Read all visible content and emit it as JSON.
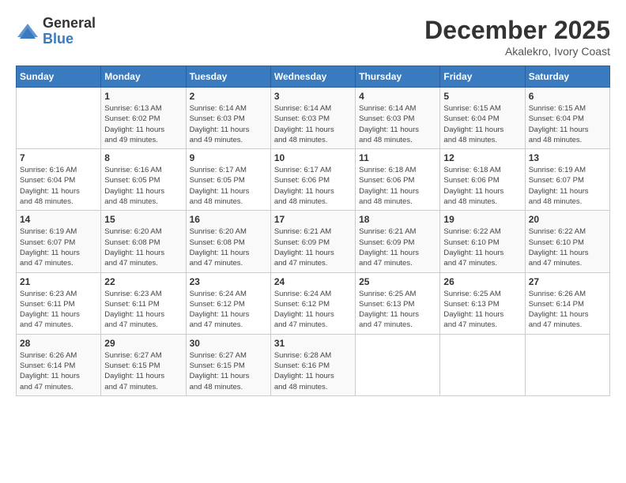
{
  "logo": {
    "general": "General",
    "blue": "Blue"
  },
  "title": "December 2025",
  "location": "Akalekro, Ivory Coast",
  "days_of_week": [
    "Sunday",
    "Monday",
    "Tuesday",
    "Wednesday",
    "Thursday",
    "Friday",
    "Saturday"
  ],
  "weeks": [
    [
      {
        "day": "",
        "info": ""
      },
      {
        "day": "1",
        "info": "Sunrise: 6:13 AM\nSunset: 6:02 PM\nDaylight: 11 hours\nand 49 minutes."
      },
      {
        "day": "2",
        "info": "Sunrise: 6:14 AM\nSunset: 6:03 PM\nDaylight: 11 hours\nand 49 minutes."
      },
      {
        "day": "3",
        "info": "Sunrise: 6:14 AM\nSunset: 6:03 PM\nDaylight: 11 hours\nand 48 minutes."
      },
      {
        "day": "4",
        "info": "Sunrise: 6:14 AM\nSunset: 6:03 PM\nDaylight: 11 hours\nand 48 minutes."
      },
      {
        "day": "5",
        "info": "Sunrise: 6:15 AM\nSunset: 6:04 PM\nDaylight: 11 hours\nand 48 minutes."
      },
      {
        "day": "6",
        "info": "Sunrise: 6:15 AM\nSunset: 6:04 PM\nDaylight: 11 hours\nand 48 minutes."
      }
    ],
    [
      {
        "day": "7",
        "info": "Sunrise: 6:16 AM\nSunset: 6:04 PM\nDaylight: 11 hours\nand 48 minutes."
      },
      {
        "day": "8",
        "info": "Sunrise: 6:16 AM\nSunset: 6:05 PM\nDaylight: 11 hours\nand 48 minutes."
      },
      {
        "day": "9",
        "info": "Sunrise: 6:17 AM\nSunset: 6:05 PM\nDaylight: 11 hours\nand 48 minutes."
      },
      {
        "day": "10",
        "info": "Sunrise: 6:17 AM\nSunset: 6:06 PM\nDaylight: 11 hours\nand 48 minutes."
      },
      {
        "day": "11",
        "info": "Sunrise: 6:18 AM\nSunset: 6:06 PM\nDaylight: 11 hours\nand 48 minutes."
      },
      {
        "day": "12",
        "info": "Sunrise: 6:18 AM\nSunset: 6:06 PM\nDaylight: 11 hours\nand 48 minutes."
      },
      {
        "day": "13",
        "info": "Sunrise: 6:19 AM\nSunset: 6:07 PM\nDaylight: 11 hours\nand 48 minutes."
      }
    ],
    [
      {
        "day": "14",
        "info": "Sunrise: 6:19 AM\nSunset: 6:07 PM\nDaylight: 11 hours\nand 47 minutes."
      },
      {
        "day": "15",
        "info": "Sunrise: 6:20 AM\nSunset: 6:08 PM\nDaylight: 11 hours\nand 47 minutes."
      },
      {
        "day": "16",
        "info": "Sunrise: 6:20 AM\nSunset: 6:08 PM\nDaylight: 11 hours\nand 47 minutes."
      },
      {
        "day": "17",
        "info": "Sunrise: 6:21 AM\nSunset: 6:09 PM\nDaylight: 11 hours\nand 47 minutes."
      },
      {
        "day": "18",
        "info": "Sunrise: 6:21 AM\nSunset: 6:09 PM\nDaylight: 11 hours\nand 47 minutes."
      },
      {
        "day": "19",
        "info": "Sunrise: 6:22 AM\nSunset: 6:10 PM\nDaylight: 11 hours\nand 47 minutes."
      },
      {
        "day": "20",
        "info": "Sunrise: 6:22 AM\nSunset: 6:10 PM\nDaylight: 11 hours\nand 47 minutes."
      }
    ],
    [
      {
        "day": "21",
        "info": "Sunrise: 6:23 AM\nSunset: 6:11 PM\nDaylight: 11 hours\nand 47 minutes."
      },
      {
        "day": "22",
        "info": "Sunrise: 6:23 AM\nSunset: 6:11 PM\nDaylight: 11 hours\nand 47 minutes."
      },
      {
        "day": "23",
        "info": "Sunrise: 6:24 AM\nSunset: 6:12 PM\nDaylight: 11 hours\nand 47 minutes."
      },
      {
        "day": "24",
        "info": "Sunrise: 6:24 AM\nSunset: 6:12 PM\nDaylight: 11 hours\nand 47 minutes."
      },
      {
        "day": "25",
        "info": "Sunrise: 6:25 AM\nSunset: 6:13 PM\nDaylight: 11 hours\nand 47 minutes."
      },
      {
        "day": "26",
        "info": "Sunrise: 6:25 AM\nSunset: 6:13 PM\nDaylight: 11 hours\nand 47 minutes."
      },
      {
        "day": "27",
        "info": "Sunrise: 6:26 AM\nSunset: 6:14 PM\nDaylight: 11 hours\nand 47 minutes."
      }
    ],
    [
      {
        "day": "28",
        "info": "Sunrise: 6:26 AM\nSunset: 6:14 PM\nDaylight: 11 hours\nand 47 minutes."
      },
      {
        "day": "29",
        "info": "Sunrise: 6:27 AM\nSunset: 6:15 PM\nDaylight: 11 hours\nand 47 minutes."
      },
      {
        "day": "30",
        "info": "Sunrise: 6:27 AM\nSunset: 6:15 PM\nDaylight: 11 hours\nand 48 minutes."
      },
      {
        "day": "31",
        "info": "Sunrise: 6:28 AM\nSunset: 6:16 PM\nDaylight: 11 hours\nand 48 minutes."
      },
      {
        "day": "",
        "info": ""
      },
      {
        "day": "",
        "info": ""
      },
      {
        "day": "",
        "info": ""
      }
    ]
  ]
}
